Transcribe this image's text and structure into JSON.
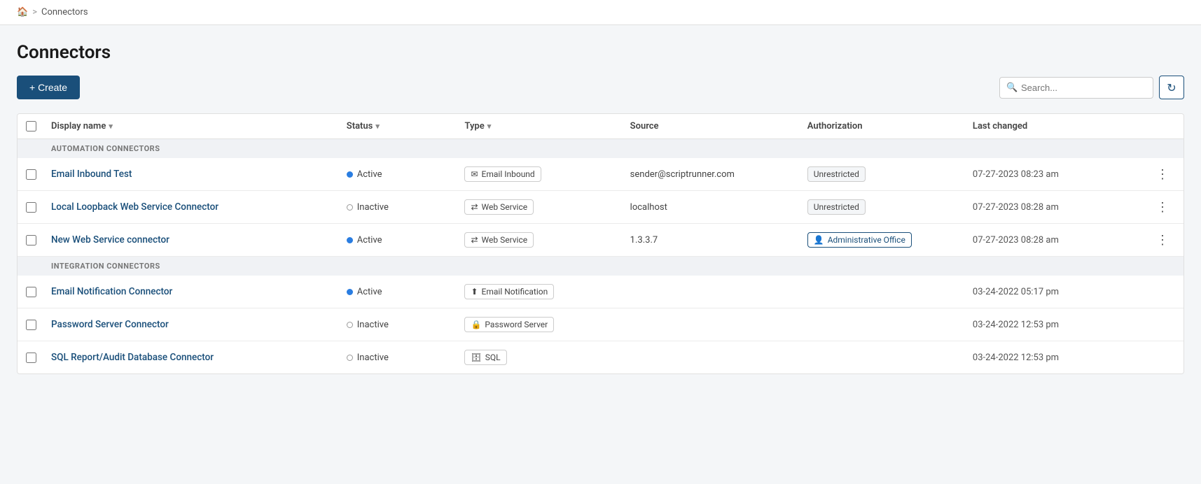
{
  "breadcrumb": {
    "home_label": "🏠",
    "separator": ">",
    "current": "Connectors"
  },
  "page": {
    "title": "Connectors"
  },
  "toolbar": {
    "create_label": "+ Create",
    "search_placeholder": "Search...",
    "refresh_icon": "↻"
  },
  "table": {
    "columns": {
      "display_name": "Display name",
      "status": "Status",
      "type": "Type",
      "source": "Source",
      "authorization": "Authorization",
      "last_changed": "Last changed"
    },
    "sections": [
      {
        "section_label": "AUTOMATION CONNECTORS",
        "rows": [
          {
            "name": "Email Inbound Test",
            "status": "Active",
            "status_type": "active",
            "type_icon": "✉",
            "type_label": "Email Inbound",
            "source": "sender@scriptrunner.com",
            "auth_label": "Unrestricted",
            "auth_type": "unrestricted",
            "last_changed": "07-27-2023 08:23 am",
            "has_menu": true
          },
          {
            "name": "Local Loopback Web Service Connector",
            "status": "Inactive",
            "status_type": "inactive",
            "type_icon": "⇄",
            "type_label": "Web Service",
            "source": "localhost",
            "auth_label": "Unrestricted",
            "auth_type": "unrestricted",
            "last_changed": "07-27-2023 08:28 am",
            "has_menu": true
          },
          {
            "name": "New Web Service connector",
            "status": "Active",
            "status_type": "active",
            "type_icon": "⇄",
            "type_label": "Web Service",
            "source": "1.3.3.7",
            "auth_label": "Administrative Office",
            "auth_type": "admin",
            "last_changed": "07-27-2023 08:28 am",
            "has_menu": true
          }
        ]
      },
      {
        "section_label": "INTEGRATION CONNECTORS",
        "rows": [
          {
            "name": "Email Notification Connector",
            "status": "Active",
            "status_type": "active",
            "type_icon": "⬆",
            "type_label": "Email Notification",
            "source": "",
            "auth_label": "",
            "auth_type": "none",
            "last_changed": "03-24-2022 05:17 pm",
            "has_menu": false
          },
          {
            "name": "Password Server Connector",
            "status": "Inactive",
            "status_type": "inactive",
            "type_icon": "🔒",
            "type_label": "Password Server",
            "source": "",
            "auth_label": "",
            "auth_type": "none",
            "last_changed": "03-24-2022 12:53 pm",
            "has_menu": false
          },
          {
            "name": "SQL Report/Audit Database Connector",
            "status": "Inactive",
            "status_type": "inactive",
            "type_icon": "🗄",
            "type_label": "SQL",
            "source": "",
            "auth_label": "",
            "auth_type": "none",
            "last_changed": "03-24-2022 12:53 pm",
            "has_menu": false
          }
        ]
      }
    ]
  }
}
